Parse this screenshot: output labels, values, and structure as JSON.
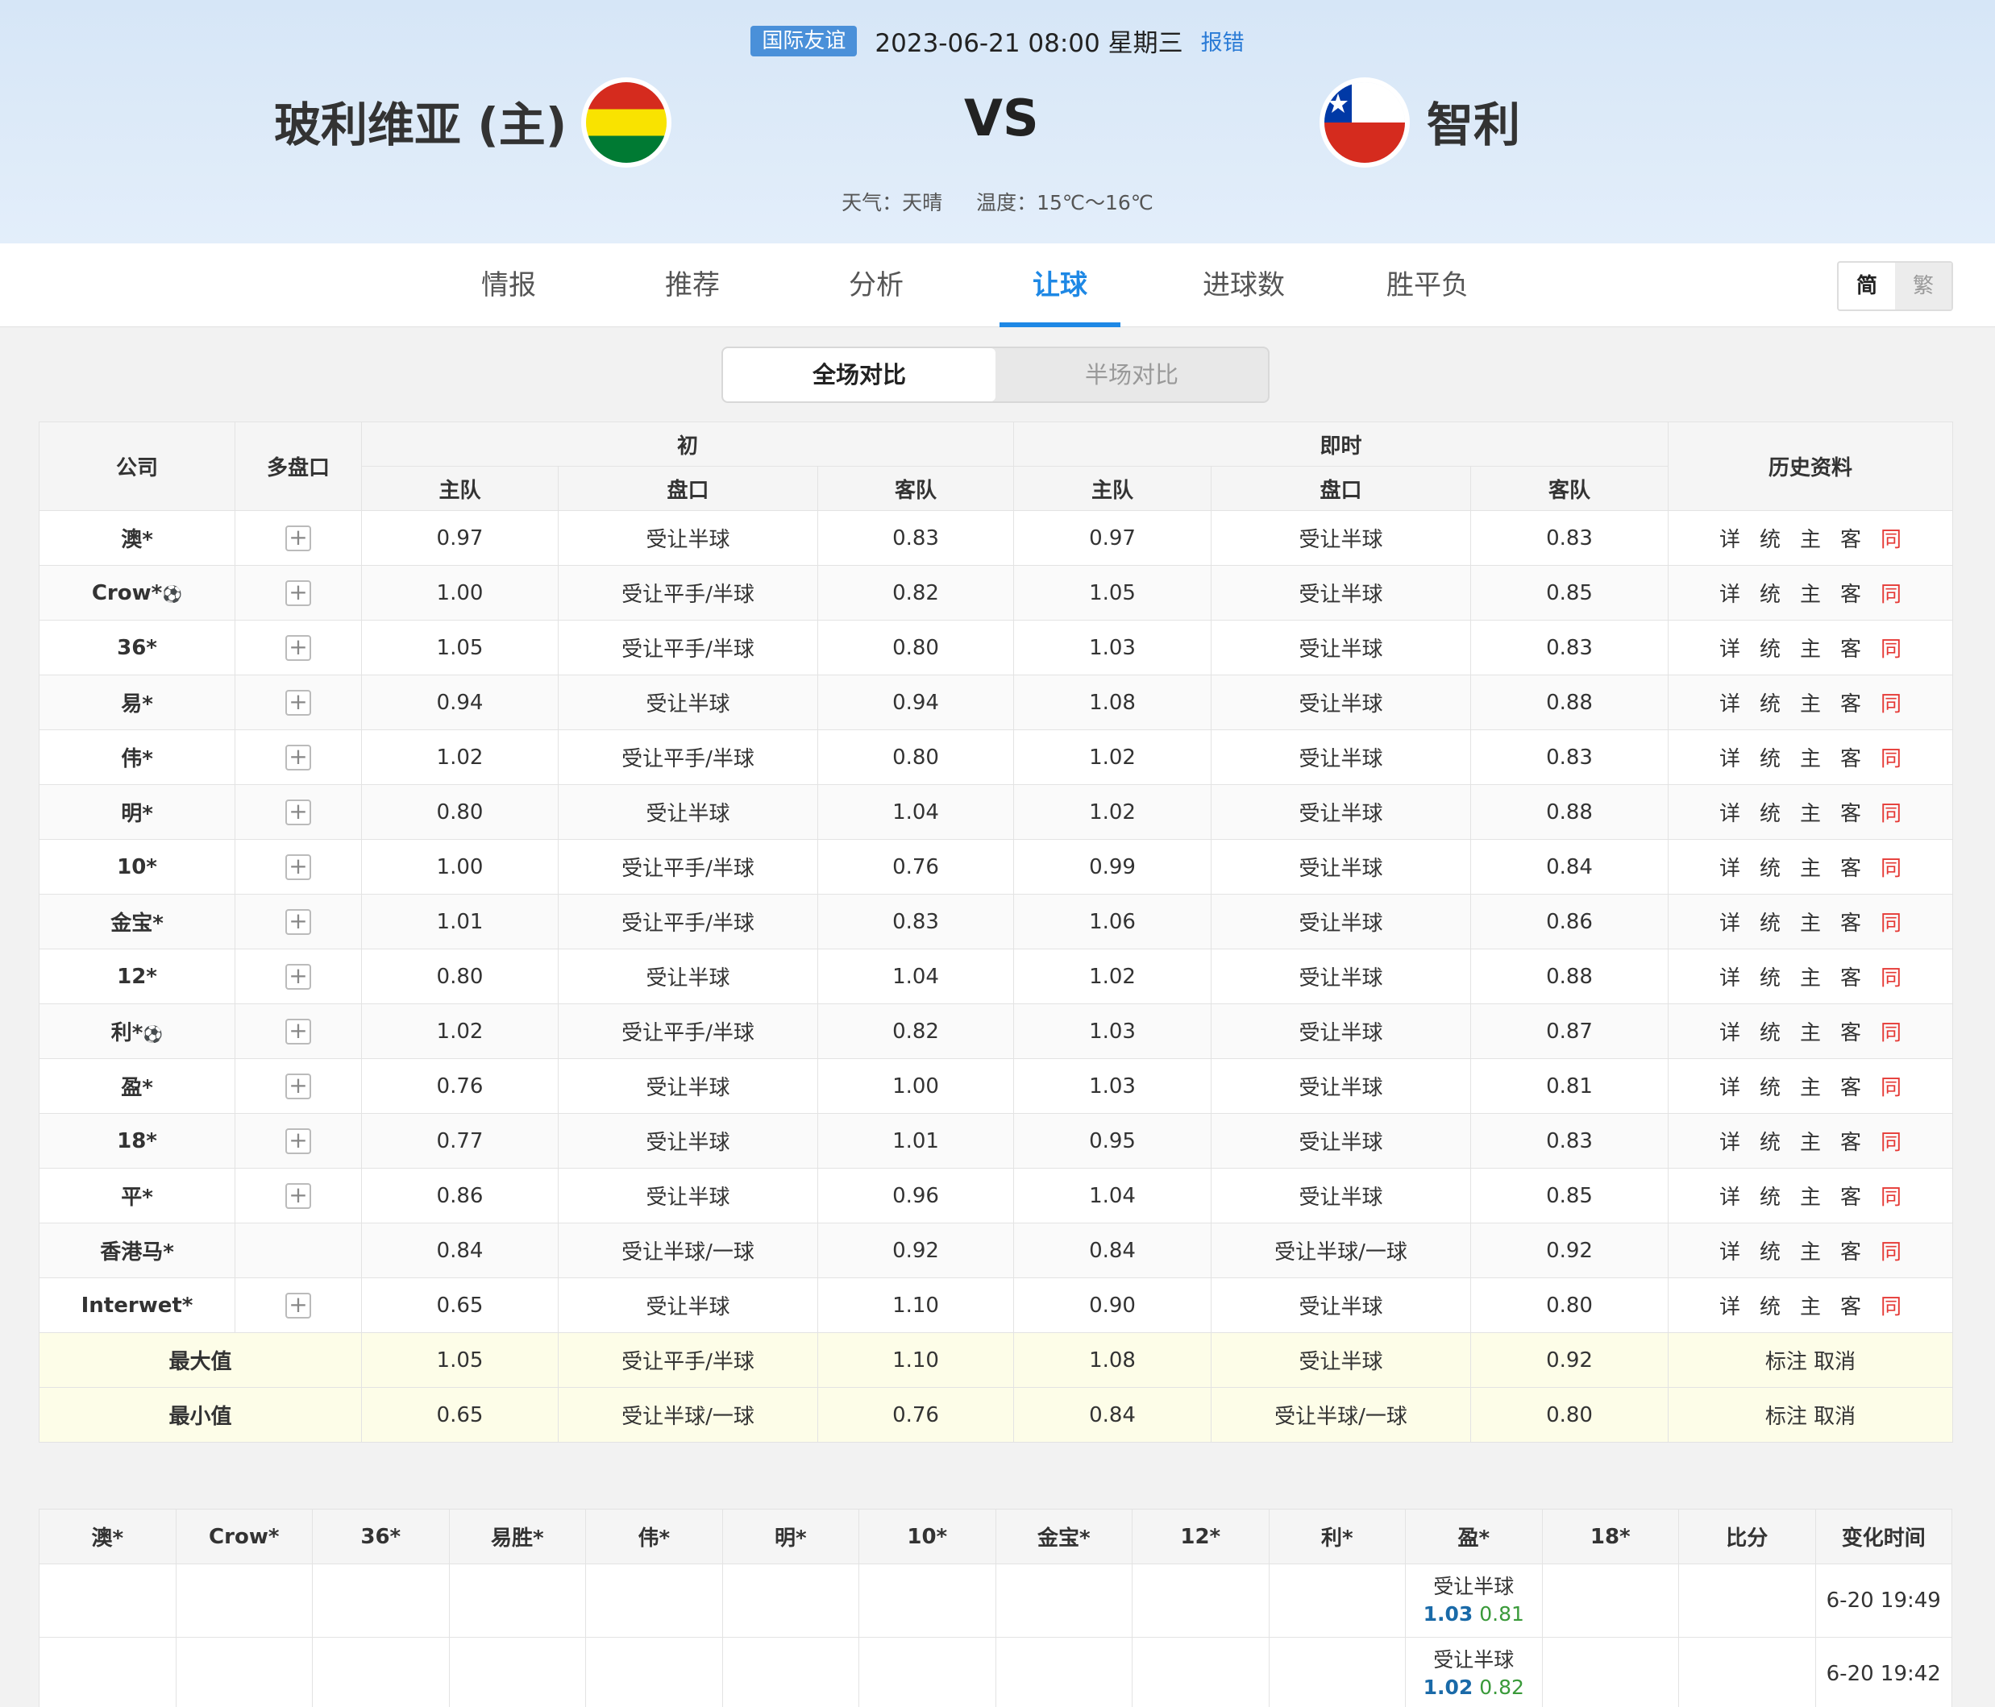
{
  "header": {
    "league": "国际友谊",
    "datetime": "2023-06-21 08:00 星期三",
    "report": "报错",
    "home": "玻利维亚 (主)",
    "vs": "VS",
    "away": "智利",
    "weather": "天气：天晴",
    "temperature": "温度：15℃～16℃"
  },
  "nav": {
    "tabs": [
      "情报",
      "推荐",
      "分析",
      "让球",
      "进球数",
      "胜平负"
    ],
    "active_index": 3,
    "lang_simplified": "简",
    "lang_traditional": "繁"
  },
  "segmented": {
    "full": "全场对比",
    "half": "半场对比"
  },
  "colors": {
    "accent": "#1e88e5",
    "same": "#e53935",
    "summary_bg": "#fdfde8"
  },
  "table": {
    "headers": {
      "company": "公司",
      "multi": "多盘口",
      "initial": "初",
      "live": "即时",
      "history": "历史资料",
      "home": "主队",
      "handicap": "盘口",
      "away": "客队"
    },
    "history_links": [
      "详",
      "统",
      "主",
      "客",
      "同"
    ],
    "rows": [
      {
        "company": "澳*",
        "ball": false,
        "multi": true,
        "ih": "0.97",
        "ip": "受让半球",
        "ia": "0.83",
        "lh": "0.97",
        "lp": "受让半球",
        "la": "0.83"
      },
      {
        "company": "Crow*",
        "ball": true,
        "multi": true,
        "ih": "1.00",
        "ip": "受让平手/半球",
        "ia": "0.82",
        "lh": "1.05",
        "lp": "受让半球",
        "la": "0.85"
      },
      {
        "company": "36*",
        "ball": false,
        "multi": true,
        "ih": "1.05",
        "ip": "受让平手/半球",
        "ia": "0.80",
        "lh": "1.03",
        "lp": "受让半球",
        "la": "0.83"
      },
      {
        "company": "易*",
        "ball": false,
        "multi": true,
        "ih": "0.94",
        "ip": "受让半球",
        "ia": "0.94",
        "lh": "1.08",
        "lp": "受让半球",
        "la": "0.88"
      },
      {
        "company": "伟*",
        "ball": false,
        "multi": true,
        "ih": "1.02",
        "ip": "受让平手/半球",
        "ia": "0.80",
        "lh": "1.02",
        "lp": "受让半球",
        "la": "0.83"
      },
      {
        "company": "明*",
        "ball": false,
        "multi": true,
        "ih": "0.80",
        "ip": "受让半球",
        "ia": "1.04",
        "lh": "1.02",
        "lp": "受让半球",
        "la": "0.88"
      },
      {
        "company": "10*",
        "ball": false,
        "multi": true,
        "ih": "1.00",
        "ip": "受让平手/半球",
        "ia": "0.76",
        "lh": "0.99",
        "lp": "受让半球",
        "la": "0.84"
      },
      {
        "company": "金宝*",
        "ball": false,
        "multi": true,
        "ih": "1.01",
        "ip": "受让平手/半球",
        "ia": "0.83",
        "lh": "1.06",
        "lp": "受让半球",
        "la": "0.86"
      },
      {
        "company": "12*",
        "ball": false,
        "multi": true,
        "ih": "0.80",
        "ip": "受让半球",
        "ia": "1.04",
        "lh": "1.02",
        "lp": "受让半球",
        "la": "0.88"
      },
      {
        "company": "利*",
        "ball": true,
        "multi": true,
        "ih": "1.02",
        "ip": "受让平手/半球",
        "ia": "0.82",
        "lh": "1.03",
        "lp": "受让半球",
        "la": "0.87"
      },
      {
        "company": "盈*",
        "ball": false,
        "multi": true,
        "ih": "0.76",
        "ip": "受让半球",
        "ia": "1.00",
        "lh": "1.03",
        "lp": "受让半球",
        "la": "0.81"
      },
      {
        "company": "18*",
        "ball": false,
        "multi": true,
        "ih": "0.77",
        "ip": "受让半球",
        "ia": "1.01",
        "lh": "0.95",
        "lp": "受让半球",
        "la": "0.83"
      },
      {
        "company": "平*",
        "ball": false,
        "multi": true,
        "ih": "0.86",
        "ip": "受让半球",
        "ia": "0.96",
        "lh": "1.04",
        "lp": "受让半球",
        "la": "0.85"
      },
      {
        "company": "香港马*",
        "ball": false,
        "multi": false,
        "ih": "0.84",
        "ip": "受让半球/一球",
        "ia": "0.92",
        "lh": "0.84",
        "lp": "受让半球/一球",
        "la": "0.92"
      },
      {
        "company": "Interwet*",
        "ball": false,
        "multi": true,
        "ih": "0.65",
        "ip": "受让半球",
        "ia": "1.10",
        "lh": "0.90",
        "lp": "受让半球",
        "la": "0.80"
      }
    ],
    "summary": [
      {
        "label": "最大值",
        "ih": "1.05",
        "ip": "受让平手/半球",
        "ia": "1.10",
        "lh": "1.08",
        "lp": "受让半球",
        "la": "0.92",
        "actions": "标注 取消"
      },
      {
        "label": "最小值",
        "ih": "0.65",
        "ip": "受让半球/一球",
        "ia": "0.76",
        "lh": "0.84",
        "lp": "受让半球/一球",
        "la": "0.80",
        "actions": "标注 取消"
      }
    ]
  },
  "changes": {
    "headers": [
      "澳*",
      "Crow*",
      "36*",
      "易胜*",
      "伟*",
      "明*",
      "10*",
      "金宝*",
      "12*",
      "利*",
      "盈*",
      "18*",
      "比分",
      "变化时间"
    ],
    "rows": [
      {
        "col": 10,
        "handicap": "受让半球",
        "home": "1.03",
        "away": "0.81",
        "time": "6-20 19:49"
      },
      {
        "col": 10,
        "handicap": "受让半球",
        "home": "1.02",
        "away": "0.82",
        "time": "6-20 19:42"
      }
    ]
  }
}
